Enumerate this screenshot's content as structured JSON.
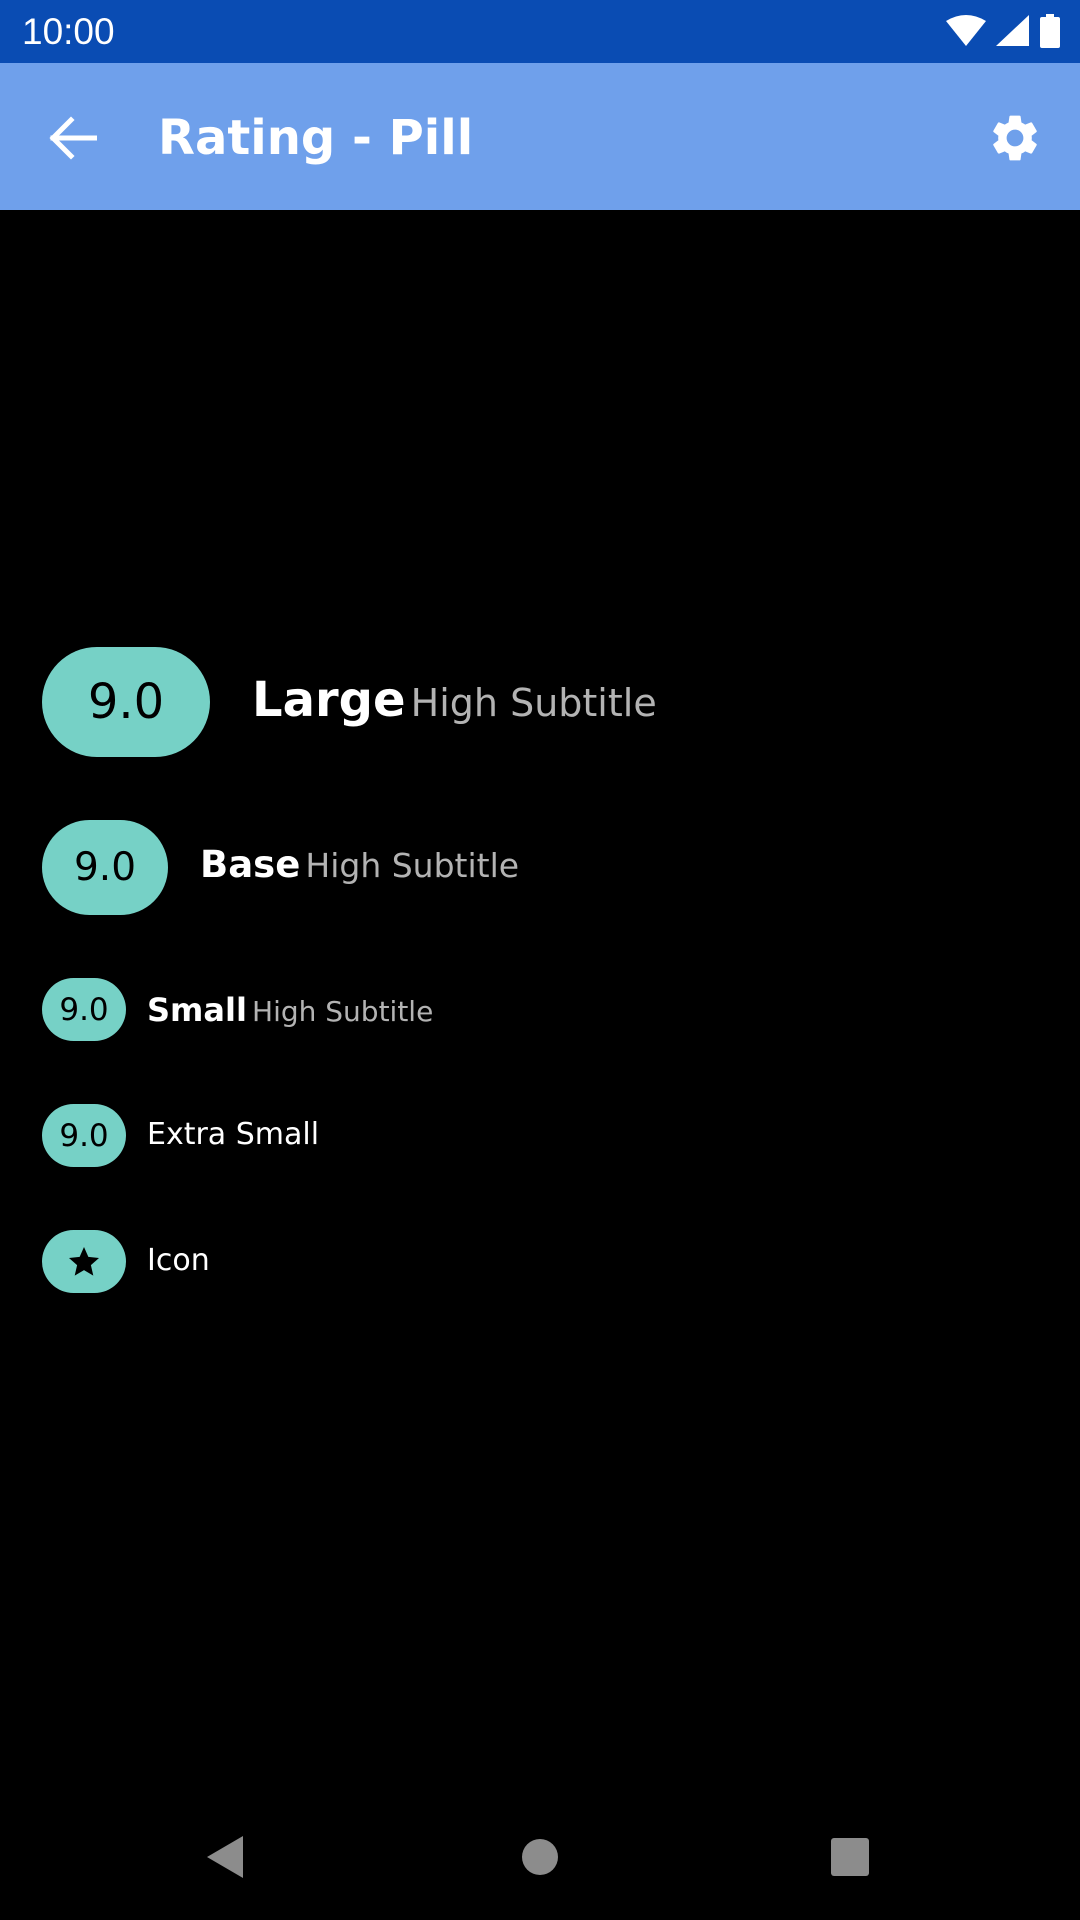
{
  "status_bar": {
    "time": "10:00",
    "icons": [
      "wifi-icon",
      "signal-icon",
      "battery-icon"
    ],
    "color": "#0a4cb3"
  },
  "app_bar": {
    "title": "Rating - Pill",
    "back_icon": "arrow-back-icon",
    "settings_icon": "gear-icon",
    "color": "#6fa0eb"
  },
  "ratings": {
    "large": {
      "value": "9.0",
      "title": "Large",
      "subtitle": "High Subtitle"
    },
    "base": {
      "value": "9.0",
      "title": "Base",
      "subtitle": "High Subtitle"
    },
    "small": {
      "value": "9.0",
      "title": "Small",
      "subtitle": "High Subtitle"
    },
    "extra_small": {
      "value": "9.0",
      "label": "Extra Small"
    },
    "icon": {
      "icon": "star-icon",
      "label": "Icon"
    }
  },
  "pill_color": "#76d1c6",
  "nav_bar": {
    "buttons": [
      "back-triangle-icon",
      "home-circle-icon",
      "recents-square-icon"
    ]
  }
}
